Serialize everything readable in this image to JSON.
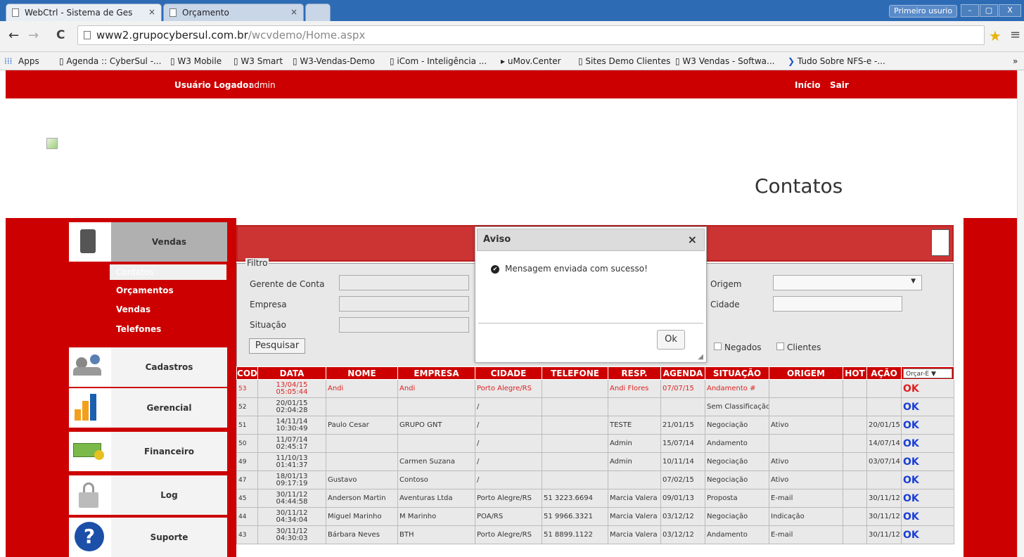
{
  "browser": {
    "tabs": [
      {
        "title": "WebCtrl - Sistema de Ges",
        "close": "×"
      },
      {
        "title": "Orçamento",
        "close": "×"
      }
    ],
    "user": "Primeiro usurio",
    "url_host": "www2.grupocybersul.com.br",
    "url_path": "/wcvdemo/Home.aspx",
    "bookmarks": [
      "Apps",
      "Agenda :: CyberSul -...",
      "W3 Mobile",
      "W3 Smart",
      "W3-Vendas-Demo",
      "iCom - Inteligência ...",
      "uMov.Center",
      "Sites Demo Clientes",
      "W3 Vendas - Softwa...",
      "Tudo Sobre NFS-e -..."
    ],
    "overflow": "»"
  },
  "topbar": {
    "user_label": "Usuário Logado:",
    "user_name": "admin",
    "inicio": "Início",
    "sair": "Sair"
  },
  "page_title": "Contatos",
  "menu": {
    "vendas": "Vendas",
    "sub": [
      "Contatos",
      "Orçamentos",
      "Vendas",
      "Telefones"
    ],
    "cadastros": "Cadastros",
    "gerencial": "Gerencial",
    "financeiro": "Financeiro",
    "log": "Log",
    "suporte": "Suporte"
  },
  "filter": {
    "legend": "Filtro",
    "gerente": "Gerente de Conta",
    "empresa": "Empresa",
    "situacao": "Situação",
    "origem": "Origem",
    "cidade": "Cidade",
    "pesquisar": "Pesquisar",
    "negados": "Negados",
    "clientes": "Clientes"
  },
  "table": {
    "headers": [
      "COD",
      "DATA",
      "NOME",
      "EMPRESA",
      "CIDADE",
      "TELEFONE",
      "RESP.",
      "AGENDA",
      "SITUAÇÃO",
      "ORIGEM",
      "HOT",
      "AÇÃO"
    ],
    "action_select": "Orçar-E",
    "rows": [
      [
        "53",
        "13/04/15 05:05:44",
        "Andi",
        "Andi",
        "Porto Alegre/RS",
        "",
        "Andi Flores",
        "07/07/15",
        "Andamento #",
        "",
        "",
        "",
        "OK"
      ],
      [
        "52",
        "20/01/15 02:04:28",
        "",
        "",
        "/",
        "",
        "",
        "",
        "Sem Classificação",
        "",
        "",
        "",
        "OK"
      ],
      [
        "51",
        "14/11/14 10:30:49",
        "Paulo Cesar",
        "GRUPO GNT",
        "/",
        "",
        "TESTE",
        "21/01/15",
        "Negociação",
        "Ativo",
        "",
        "20/01/15",
        "OK"
      ],
      [
        "50",
        "11/07/14 02:45:17",
        "",
        "",
        "/",
        "",
        "Admin",
        "15/07/14",
        "Andamento",
        "",
        "",
        "14/07/14",
        "OK"
      ],
      [
        "49",
        "11/10/13 01:41:37",
        "",
        "Carmen Suzana",
        "/",
        "",
        "Admin",
        "10/11/14",
        "Negociação",
        "Ativo",
        "",
        "03/07/14",
        "OK"
      ],
      [
        "47",
        "18/01/13 09:17:19",
        "Gustavo",
        "Contoso",
        "/",
        "",
        "",
        "07/02/15",
        "Negociação",
        "Ativo",
        "",
        "",
        "OK"
      ],
      [
        "45",
        "30/11/12 04:44:58",
        "Anderson Martin",
        "Aventuras Ltda",
        "Porto Alegre/RS",
        "51 3223.6694",
        "Marcia Valera",
        "09/01/13",
        "Proposta",
        "E-mail",
        "",
        "30/11/12",
        "OK"
      ],
      [
        "44",
        "30/11/12 04:34:04",
        "Miguel Marinho",
        "M Marinho",
        "POA/RS",
        "51 9966.3321",
        "Marcia Valera",
        "03/12/12",
        "Negociação",
        "Indicação",
        "",
        "30/11/12",
        "OK"
      ],
      [
        "43",
        "30/11/12 04:30:03",
        "Bárbara Neves",
        "BTH",
        "Porto Alegre/RS",
        "51 8899.1122",
        "Marcia Valera",
        "03/12/12",
        "Andamento",
        "E-mail",
        "",
        "30/11/12",
        "OK"
      ]
    ]
  },
  "modal": {
    "title": "Aviso",
    "close": "×",
    "message": "Mensagem enviada com sucesso!",
    "ok": "Ok"
  }
}
